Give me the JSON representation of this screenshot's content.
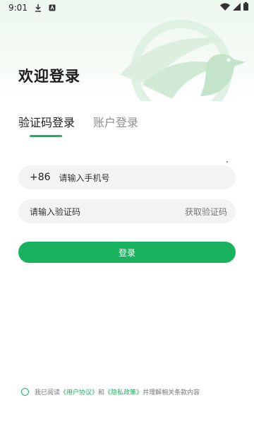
{
  "status": {
    "time": "9:01"
  },
  "page": {
    "title": "欢迎登录"
  },
  "tabs": [
    {
      "label": "验证码登录",
      "active": true
    },
    {
      "label": "账户登录",
      "active": false
    }
  ],
  "phone": {
    "prefix": "+86",
    "placeholder": "请输入手机号"
  },
  "code": {
    "placeholder": "请输入验证码",
    "get_code": "获取验证码"
  },
  "login": {
    "label": "登录"
  },
  "agreement": {
    "prefix": "我已阅读",
    "user_agreement": "《用户协议》",
    "and": "和",
    "privacy_policy": "《隐私政策》",
    "suffix": "并理解相关条款内容"
  },
  "colors": {
    "accent": "#19b35f",
    "field_bg": "#f2f3f5",
    "hero_bg": "#edf8ef"
  }
}
